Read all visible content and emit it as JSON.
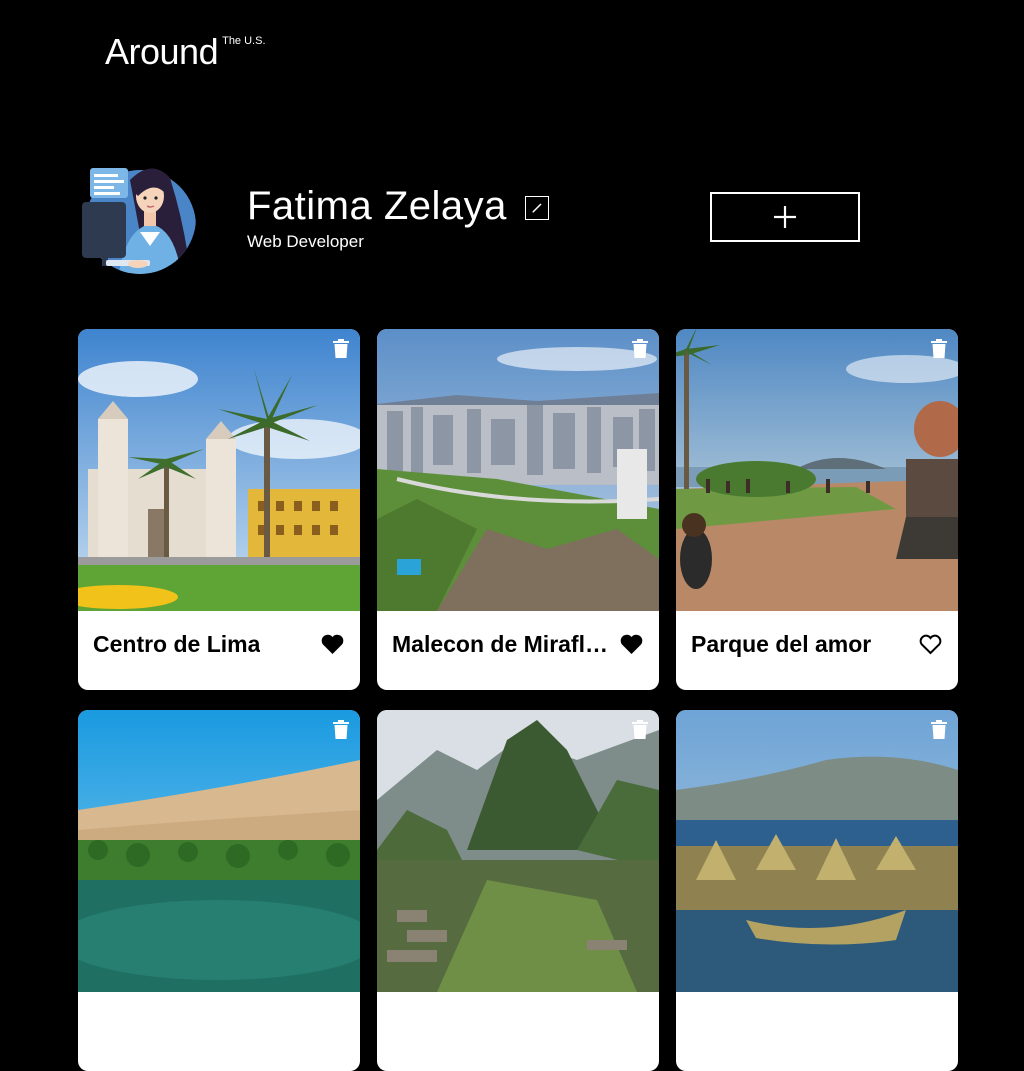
{
  "header": {
    "logo_main": "Around",
    "logo_sup": "The U.S."
  },
  "profile": {
    "name": "Fatima Zelaya",
    "job": "Web Developer",
    "avatar_icon": "avatar-woman-at-computer",
    "edit_icon": "pencil-icon",
    "add_icon": "plus-icon"
  },
  "cards": [
    {
      "title": "Centro de Lima",
      "liked": true,
      "image": "cathedral-plaza-palms"
    },
    {
      "title": "Malecon de Miraflores",
      "liked": true,
      "image": "coastal-city-cliffs"
    },
    {
      "title": "Parque del amor",
      "liked": false,
      "image": "sunset-park-sculpture"
    },
    {
      "title": "",
      "liked": false,
      "image": "desert-oasis-dunes"
    },
    {
      "title": "",
      "liked": false,
      "image": "machu-picchu-mountains"
    },
    {
      "title": "",
      "liked": false,
      "image": "reed-island-lake"
    }
  ],
  "colors": {
    "background": "#000000",
    "text": "#ffffff",
    "card": "#ffffff",
    "card_text": "#000000"
  }
}
